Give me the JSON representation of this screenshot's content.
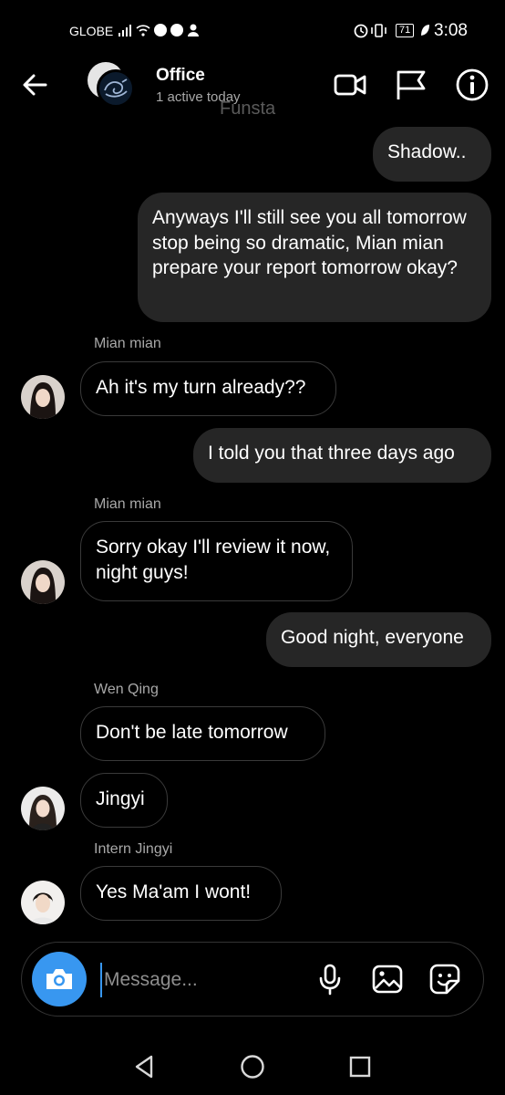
{
  "status_bar": {
    "carrier": "GLOBE",
    "battery": "71",
    "time": "3:08"
  },
  "header": {
    "title": "Office",
    "subtitle": "1 active today",
    "watermark": "Funsta"
  },
  "messages": [
    {
      "from": "me",
      "text": "Shadow.."
    },
    {
      "from": "me",
      "text": "Anyways I'll still see you all tomorrow stop being so dramatic, Mian mian prepare your report tomorrow okay?"
    },
    {
      "from": "Mian mian",
      "text": "Ah it's my turn already??"
    },
    {
      "from": "me",
      "text": "I told you that three days ago"
    },
    {
      "from": "Mian mian",
      "text": "Sorry okay I'll review it now, night guys!"
    },
    {
      "from": "me",
      "text": "Good night, everyone"
    },
    {
      "from": "Wen Qing",
      "text": "Don't be late tomorrow"
    },
    {
      "from": "Wen Qing",
      "text": "Jingyi"
    },
    {
      "from": "Intern Jingyi",
      "text": "Yes Ma'am I wont!"
    }
  ],
  "senders": {
    "mian_mian": "Mian mian",
    "wen_qing": "Wen Qing",
    "intern_jingyi": "Intern Jingyi"
  },
  "composer": {
    "placeholder": "Message..."
  },
  "colors": {
    "accent": "#3897f0",
    "outgoing_bubble": "#262626",
    "background": "#000000"
  },
  "icons": [
    "back-arrow-icon",
    "video-call-icon",
    "flag-icon",
    "info-icon",
    "camera-icon",
    "microphone-icon",
    "gallery-icon",
    "sticker-icon"
  ]
}
